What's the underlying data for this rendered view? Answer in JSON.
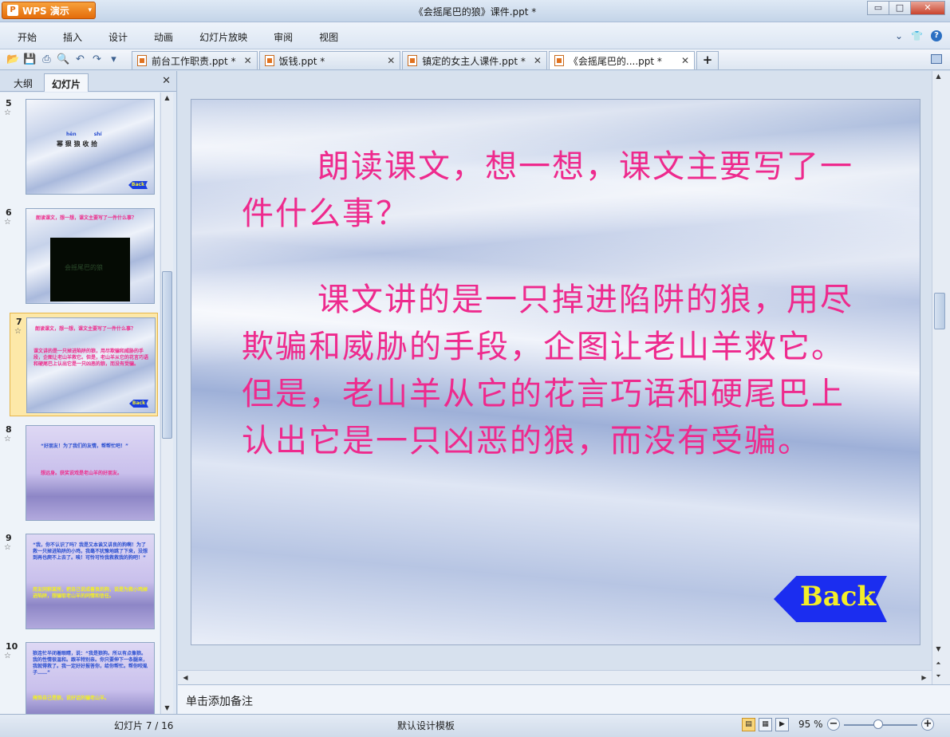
{
  "app": {
    "menu_button": "WPS 演示",
    "window_title": "《会摇尾巴的狼》课件.ppt *",
    "controls": {
      "minimize": "▭",
      "maximize": "□",
      "close": "✕"
    }
  },
  "menu": {
    "items": [
      "开始",
      "插入",
      "设计",
      "动画",
      "幻灯片放映",
      "审阅",
      "视图"
    ]
  },
  "tabs": [
    {
      "label": "前台工作职责.ppt *",
      "active": false
    },
    {
      "label": "饭钱.ppt *",
      "active": false
    },
    {
      "label": "镇定的女主人课件.ppt *",
      "active": false
    },
    {
      "label": "《会摇尾巴的....ppt *",
      "active": true
    }
  ],
  "left_panel": {
    "tab_outline": "大纲",
    "tab_slides": "幻灯片",
    "thumbnails": [
      {
        "num": "5",
        "lines": [
          "hěn shí",
          "幂 狠 狼  收 拾"
        ],
        "back": "Back"
      },
      {
        "num": "6",
        "lines": [
          "朗读课文，想一想，课文主要写了一件什么事？",
          "会摇尾巴的狼"
        ]
      },
      {
        "num": "7",
        "lines": [
          "朗读课文，想一想，课文主要写了一件什么事？",
          "课文讲的是一只掉进陷阱的狼，用尽欺骗和威胁的手段，企图让老山羊救它。但是，老山羊从它的花言巧语和硬尾巴上认出它是一只凶恶的狼，而没有受骗。"
        ],
        "back": "Back"
      },
      {
        "num": "8",
        "lines": [
          "“好朋友！为了我们的友情，帮帮忙吧！”",
          "想远身。获奖说戏是老山羊的好朋友。"
        ]
      },
      {
        "num": "9",
        "lines": [
          "“我，你不认识了吗？我是又本诶又讲良的狗啊！为了救一只掉进陷阱的小鸡，我毫不犹豫地跳了下来，没想到再也爬不上去了。唉！可怜可怜我救救我的狗吧！”",
          "用友同称某所，把自己说成善良的狗，说是为救小鸡掉进陷阱，想骗取老山羊的同情和信任。"
        ]
      },
      {
        "num": "10",
        "lines": [
          "狼连忙半闭着眼睛，说：“我是狼狗。所以有点像狼。我的性情很温和。跟羊特别亲。你只要伸下一条腿来，我就得救了。我一定好好报答你，给你帮忙。帮你咬虱子……”",
          "掩饰自己是狼，说好话的骗老山羊。"
        ]
      }
    ]
  },
  "slide": {
    "paragraph1": "朗读课文，想一想，课文主要写了一件什么事？",
    "paragraph2": "课文讲的是一只掉进陷阱的狼，用尽欺骗和威胁的手段，企图让老山羊救它。但是，老山羊从它的花言巧语和硬尾巴上认出它是一只凶恶的狼，而没有受骗。",
    "back_button": "Back",
    "text_color": "#ee2a8d"
  },
  "notes_placeholder": "单击添加备注",
  "status": {
    "slide_indicator": "幻灯片 7 / 16",
    "template": "默认设计模板",
    "zoom": "95 %"
  }
}
